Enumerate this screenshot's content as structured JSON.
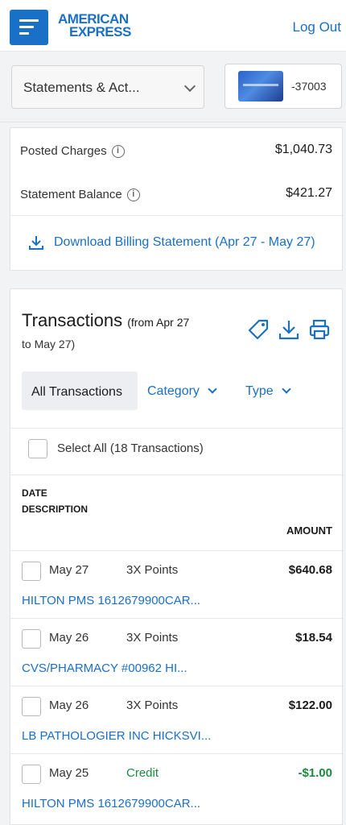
{
  "header": {
    "logo_line1": "AMERICAN",
    "logo_line2": "EXPRESS",
    "logout": "Log Out"
  },
  "selector": {
    "statement_label": "Statements & Act...",
    "card_suffix": "-37003"
  },
  "balances": {
    "posted_label": "Posted Charges",
    "posted_value": "$1,040.73",
    "statement_label": "Statement Balance",
    "statement_value": "$421.27",
    "download_link": "Download Billing Statement (Apr 27 - May 27)"
  },
  "transactions": {
    "title": "Transactions",
    "range_line1": "(from Apr 27",
    "range_line2": "to May 27)",
    "filters": {
      "all": "All Transactions",
      "category": "Category",
      "type": "Type"
    },
    "select_all": "Select All (18 Transactions)",
    "columns": {
      "date": "DATE",
      "description": "DESCRIPTION",
      "amount": "AMOUNT"
    },
    "rows": [
      {
        "date": "May 27",
        "category": "3X Points",
        "amount": "$640.68",
        "merchant": "HILTON PMS 1612679900CAR...",
        "credit": false
      },
      {
        "date": "May 26",
        "category": "3X Points",
        "amount": "$18.54",
        "merchant": "CVS/PHARMACY #00962 HI...",
        "credit": false
      },
      {
        "date": "May 26",
        "category": "3X Points",
        "amount": "$122.00",
        "merchant": "LB PATHOLOGIER INC HICKSVI...",
        "credit": false
      },
      {
        "date": "May 25",
        "category": "Credit",
        "amount": "-$1.00",
        "merchant": "HILTON PMS 1612679900CAR...",
        "credit": true
      }
    ]
  },
  "colors": {
    "brand_blue": "#1a6fc6",
    "credit_green": "#1a8a3e"
  }
}
